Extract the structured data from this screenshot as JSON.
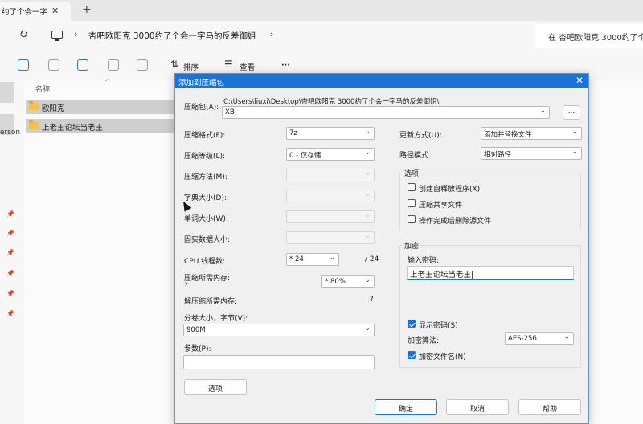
{
  "explorer": {
    "tab_title": "约了个会一字",
    "address": "杏吧欧阳克 3000约了个会一字马的反差御姐",
    "search_text": "在 杏吧欧阳克 3000约了个会",
    "toolbar": {
      "sort_label": "排序",
      "view_label": "查看",
      "more": "···"
    },
    "left_pane_text": "erson",
    "column_name": "名称",
    "files": [
      {
        "name": "欧阳克"
      },
      {
        "name": "上老王论坛当老王"
      }
    ]
  },
  "dialog": {
    "title": "添加到压缩包",
    "archive_label": "压缩包(A):",
    "archive_path": "C:\\Users\\liuxi\\Desktop\\杏吧欧阳克 3000约了个会一字马的反差御姐\\",
    "archive_name": "XB",
    "browse_label": "...",
    "format_label": "压缩格式(F):",
    "format_value": "7z",
    "level_label": "压缩等级(L):",
    "level_value": "0 - 仅存储",
    "method_label": "压缩方法(M):",
    "dict_label": "字典大小(D):",
    "word_label": "单词大小(W):",
    "solid_label": "固实数据大小:",
    "cpu_label": "CPU 线程数:",
    "cpu_value": "* 24",
    "cpu_total": "/ 24",
    "mem_label": "压缩所需内存:",
    "mem_q": "?",
    "mem_value": "* 80%",
    "decomp_label": "解压缩所需内存:",
    "decomp_value": "?",
    "split_label": "分卷大小，字节(V):",
    "split_value": "900M",
    "params_label": "参数(P):",
    "options_button": "选项",
    "update_label": "更新方式(U):",
    "update_value": "添加并替换文件",
    "path_label": "路径模式",
    "path_value": "相对路径",
    "options_group": "选项",
    "opt_sfx": "创建自释放程序(X)",
    "opt_shared": "压缩共享文件",
    "opt_delete": "操作完成后删除源文件",
    "enc_group": "加密",
    "pwd_label": "输入密码:",
    "pwd_value": "上老王论坛当老王",
    "show_pwd": "显示密码(S)",
    "enc_method_label": "加密算法:",
    "enc_method_value": "AES-256",
    "enc_names": "加密文件名(N)",
    "ok": "确定",
    "cancel": "取消",
    "help": "帮助"
  }
}
